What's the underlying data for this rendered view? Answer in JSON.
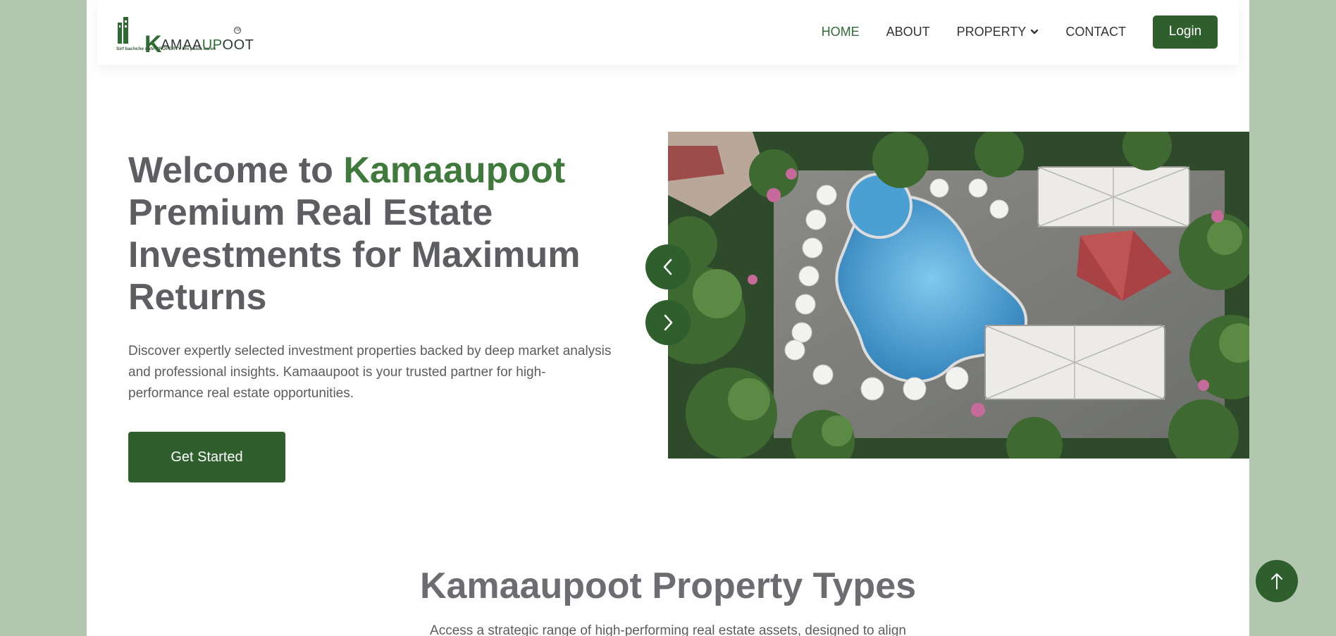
{
  "header": {
    "logo": {
      "wordmark_k": "K",
      "wordmark_rest": "AMAA",
      "wordmark_up": "UP",
      "wordmark_end": "OOT",
      "tm": "TM",
      "tagline": "Sirf bachche nahi PROPERTY bhi paida karen"
    },
    "nav": {
      "home": "HOME",
      "about": "ABOUT",
      "property": "PROPERTY",
      "contact": "CONTACT",
      "login": "Login"
    }
  },
  "hero": {
    "title_prefix": "Welcome to ",
    "title_brand": "Kamaaupoot",
    "title_rest": "Premium Real Estate Investments for Maximum Returns",
    "description": "Discover expertly selected investment properties backed by deep market analysis and professional insights. Kamaaupoot is your trusted partner for high-performance real estate opportunities.",
    "cta": "Get Started",
    "image_icon": "resort-pool-aerial-image"
  },
  "section": {
    "title": "Kamaaupoot Property Types",
    "subtitle": "Access a strategic range of high-performing real estate assets, designed to align"
  },
  "colors": {
    "brand_green": "#2e5f2c",
    "accent_green": "#3f7a3c",
    "page_bg": "#b3c6b0"
  }
}
